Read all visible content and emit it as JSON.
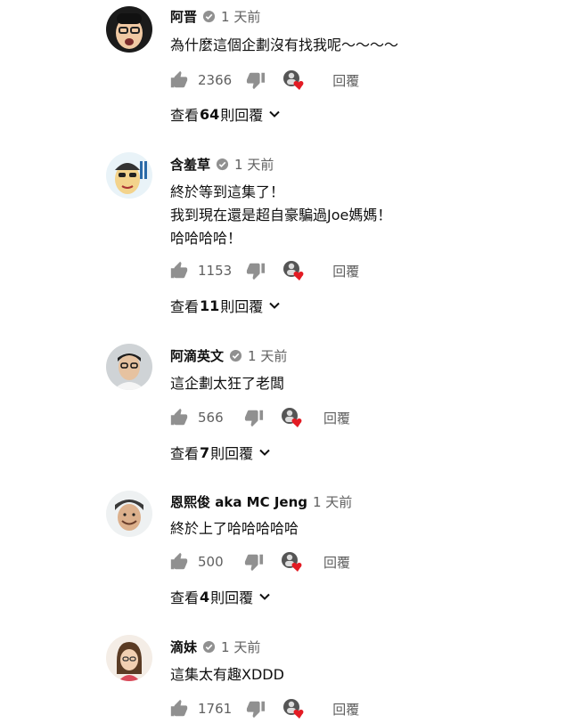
{
  "comments": [
    {
      "author": "阿晋",
      "verified": true,
      "time": "1 天前",
      "lines": [
        "為什麼這個企劃沒有找我呢～～～～"
      ],
      "likes": "2366",
      "reply_label": "回覆",
      "view_replies": {
        "prefix": "查看",
        "count": "64",
        "suffix": "則回覆"
      }
    },
    {
      "author": "含羞草",
      "verified": true,
      "time": "1 天前",
      "lines": [
        "終於等到這集了！",
        "我到現在還是超自豪騙過Joe媽媽！",
        "哈哈哈哈！"
      ],
      "likes": "1153",
      "reply_label": "回覆",
      "view_replies": {
        "prefix": "查看",
        "count": "11",
        "suffix": "則回覆"
      }
    },
    {
      "author": "阿滴英文",
      "verified": true,
      "time": "1 天前",
      "lines": [
        "這企劃太狂了老闆"
      ],
      "likes": "566",
      "reply_label": "回覆",
      "view_replies": {
        "prefix": "查看",
        "count": "7",
        "suffix": "則回覆"
      }
    },
    {
      "author": "恩熙俊 aka MC Jeng",
      "verified": false,
      "time": "1 天前",
      "lines": [
        "終於上了哈哈哈哈哈"
      ],
      "likes": "500",
      "reply_label": "回覆",
      "view_replies": {
        "prefix": "查看",
        "count": "4",
        "suffix": "則回覆"
      }
    },
    {
      "author": "滴妹",
      "verified": true,
      "time": "1 天前",
      "lines": [
        "這集太有趣XDDD"
      ],
      "likes": "1761",
      "reply_label": "回覆"
    }
  ],
  "colors": {
    "text": "#0f0f0f",
    "secondary": "#606060",
    "heart": "#e31b23",
    "icon": "#909090"
  },
  "icons": {
    "like": "thumb-up-icon",
    "dislike": "thumb-down-icon",
    "verified": "verified-check-icon",
    "creator_heart": "creator-heart-icon",
    "expand": "chevron-down-icon"
  }
}
